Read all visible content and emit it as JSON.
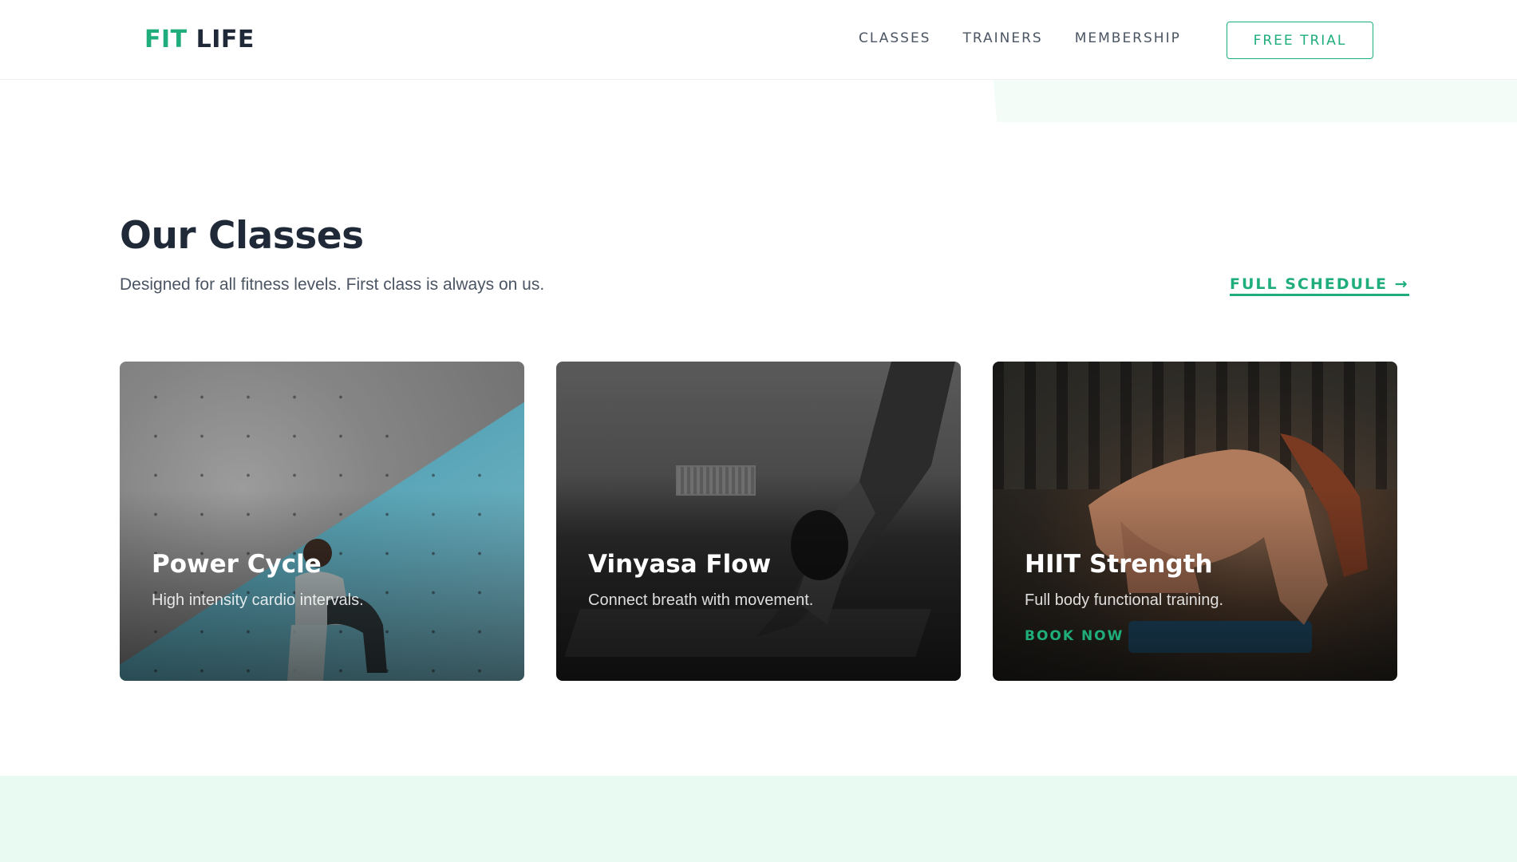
{
  "brand": {
    "part1": "FIT",
    "part2": "LIFE",
    "accent": "#1fae7b",
    "dark": "#1f2937"
  },
  "nav": {
    "links": [
      "CLASSES",
      "TRAINERS",
      "MEMBERSHIP"
    ],
    "cta": "FREE TRIAL"
  },
  "section": {
    "title": "Our Classes",
    "subtitle": "Designed for all fitness levels. First class is always on us.",
    "schedule_link": "FULL SCHEDULE →"
  },
  "cards": [
    {
      "title": "Power Cycle",
      "description": "High intensity cardio intervals.",
      "cta": ""
    },
    {
      "title": "Vinyasa Flow",
      "description": "Connect breath with movement.",
      "cta": ""
    },
    {
      "title": "HIIT Strength",
      "description": "Full body functional training.",
      "cta": "BOOK NOW"
    }
  ]
}
